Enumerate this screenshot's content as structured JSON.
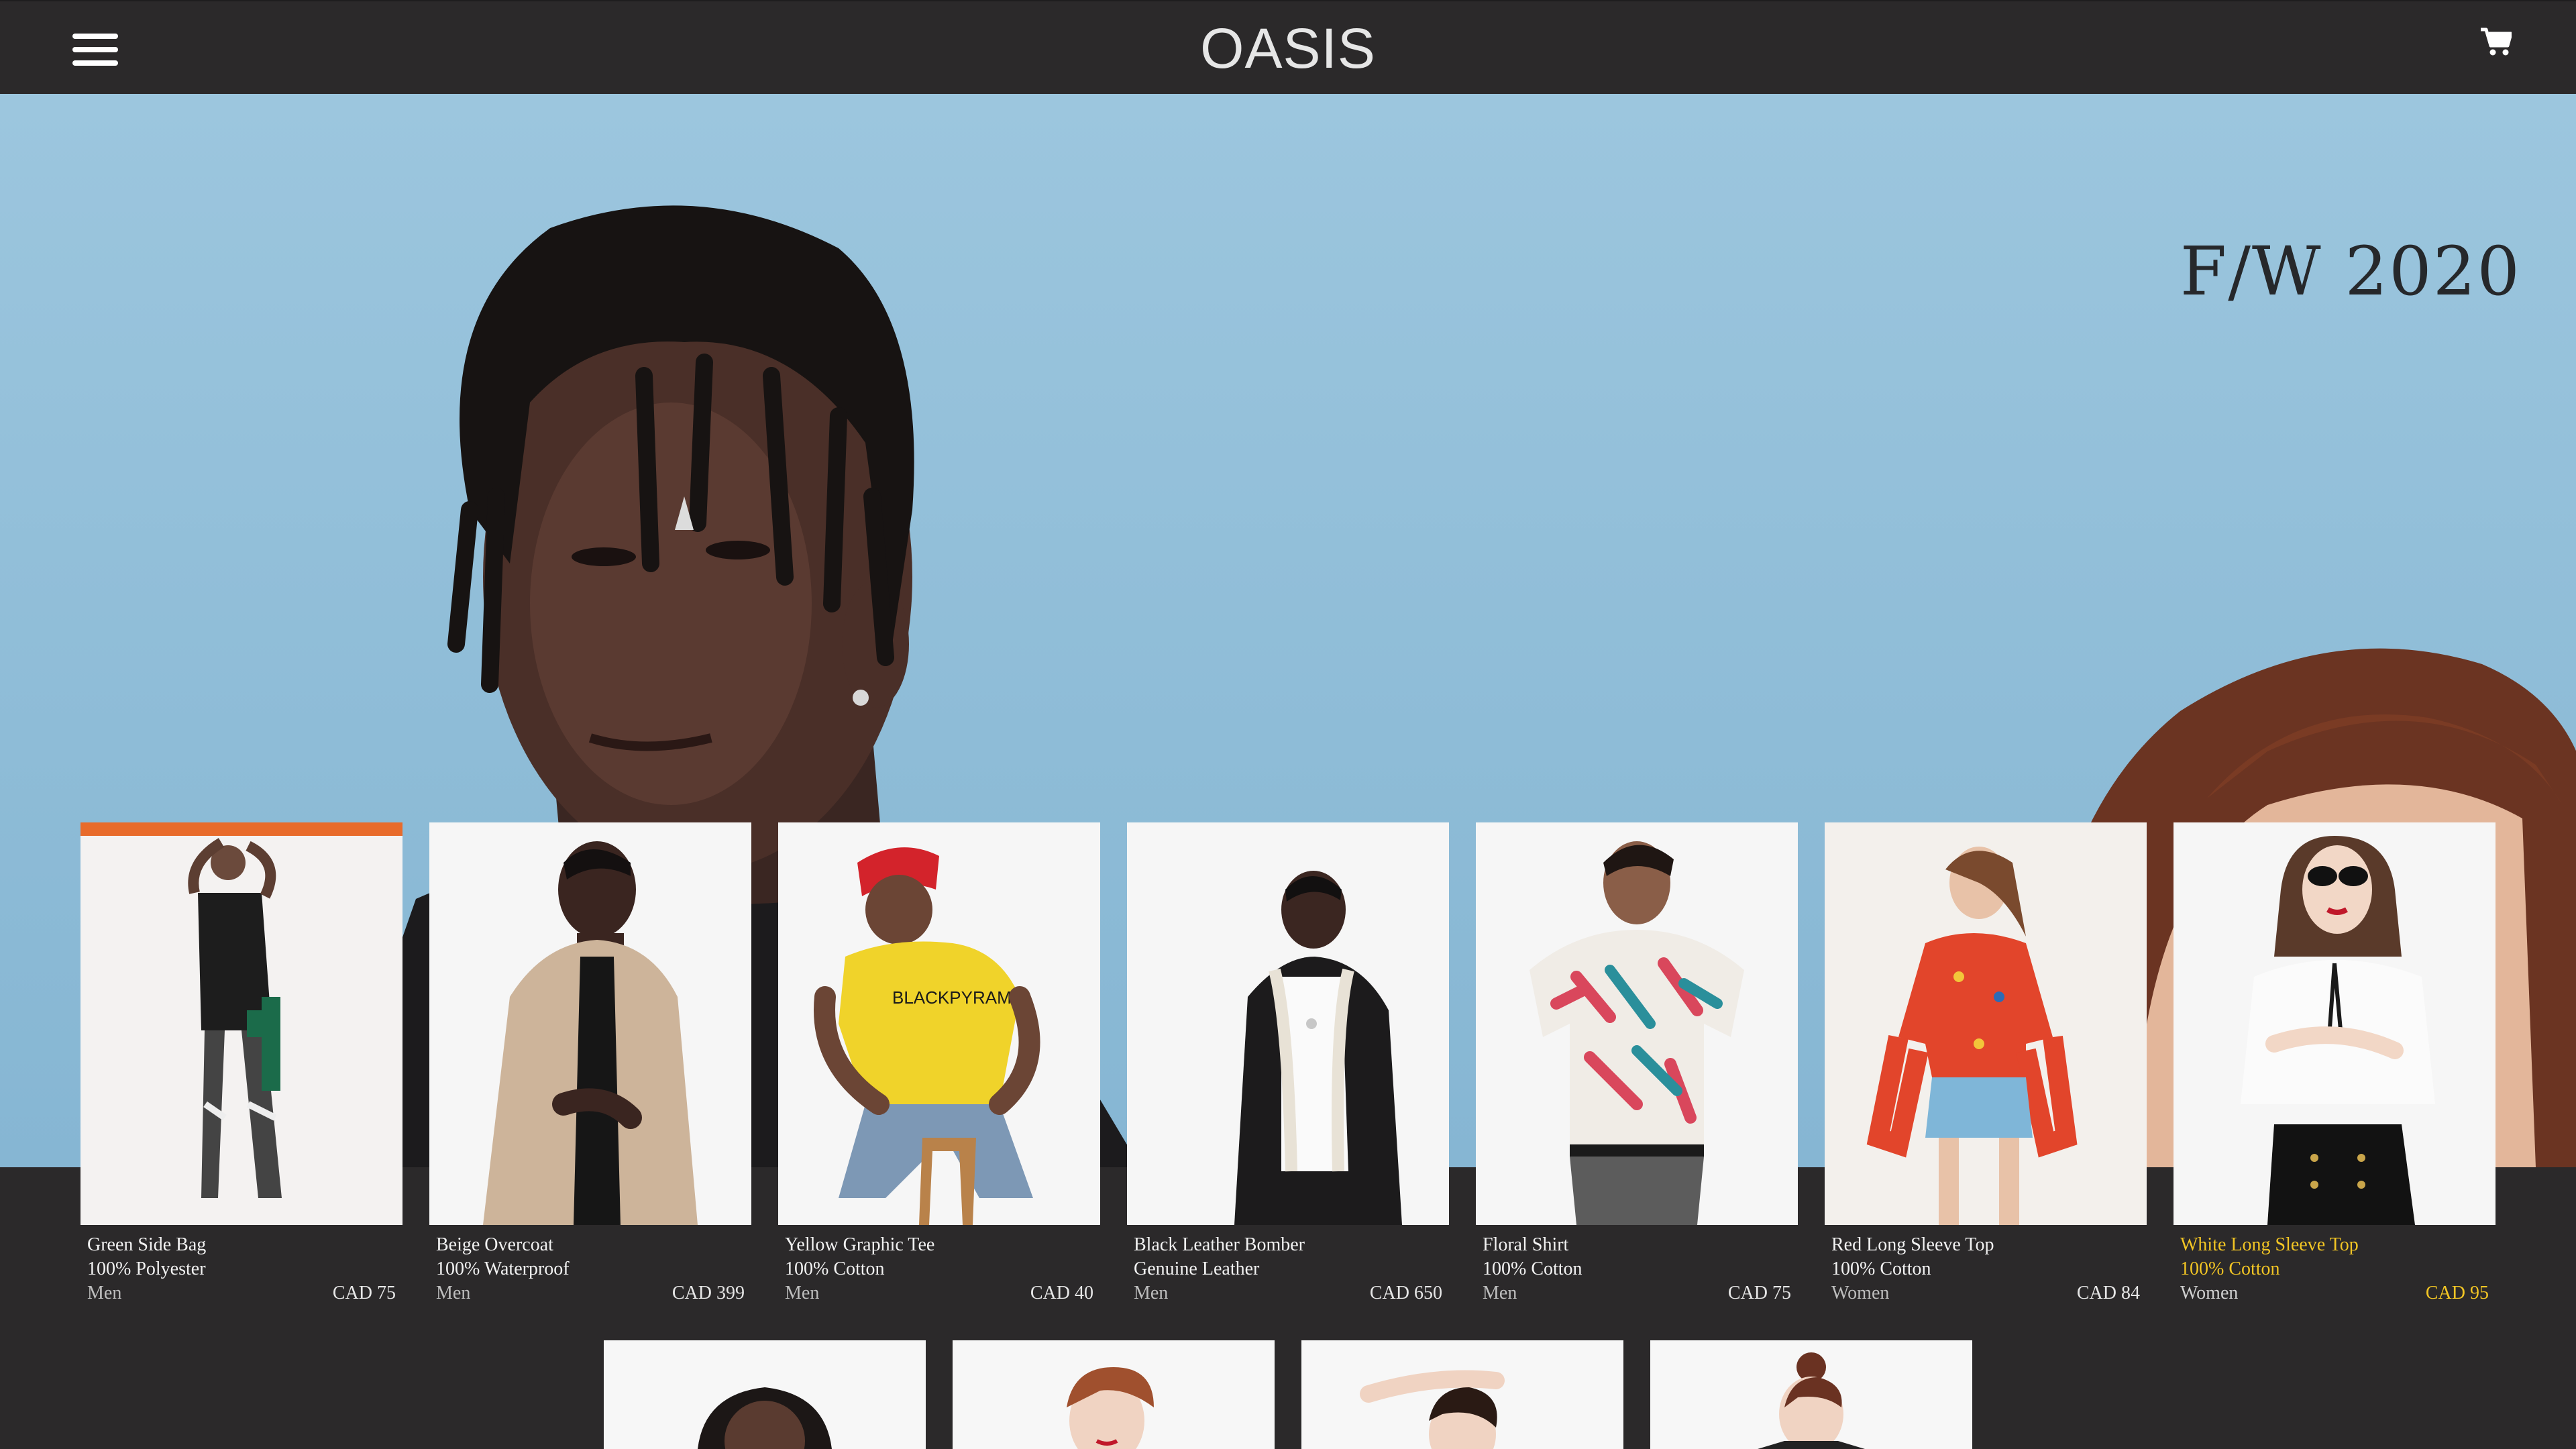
{
  "header": {
    "logo": "OASIS",
    "menu_icon": "hamburger-menu-icon",
    "cart_icon": "shopping-cart-icon"
  },
  "hero": {
    "title": "F/W 2020"
  },
  "colors": {
    "bar": "#2b292a",
    "sky": "#8ebcd7",
    "highlight": "#f2c524"
  },
  "products": [
    {
      "name": "Green Side Bag",
      "material": "100% Polyester",
      "gender": "Men",
      "price": "CAD 75"
    },
    {
      "name": "Beige Overcoat",
      "material": "100% Waterproof",
      "gender": "Men",
      "price": "CAD 399"
    },
    {
      "name": "Yellow Graphic Tee",
      "material": "100% Cotton",
      "gender": "Men",
      "price": "CAD 40"
    },
    {
      "name": "Black Leather Bomber",
      "material": "Genuine Leather",
      "gender": "Men",
      "price": "CAD 650"
    },
    {
      "name": "Floral Shirt",
      "material": "100% Cotton",
      "gender": "Men",
      "price": "CAD 75"
    },
    {
      "name": "Red Long Sleeve Top",
      "material": "100% Cotton",
      "gender": "Women",
      "price": "CAD 84"
    },
    {
      "name": "White Long Sleeve Top",
      "material": "100% Cotton",
      "gender": "Women",
      "price": "CAD 95"
    }
  ]
}
